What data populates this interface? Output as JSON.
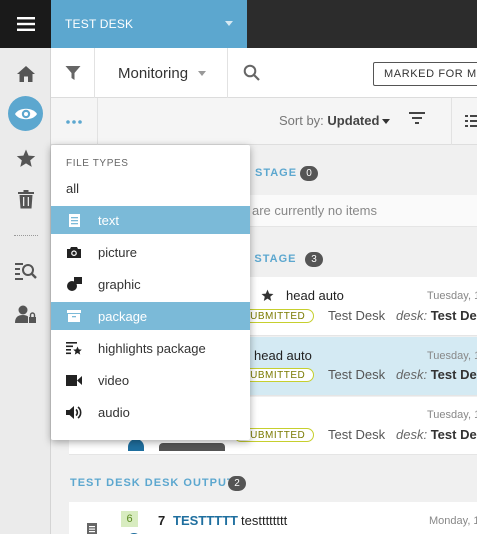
{
  "header": {
    "desk_name": "TEST DESK"
  },
  "toolbar": {
    "view_label": "Monitoring",
    "marked_button": "MARKED FOR ME"
  },
  "subbar": {
    "sort_prefix": "Sort by:",
    "sort_value": "Updated"
  },
  "dropdown": {
    "heading": "FILE TYPES",
    "items": [
      {
        "label": "all",
        "icon": "none",
        "selected": false
      },
      {
        "label": "text",
        "icon": "text-icon",
        "selected": true
      },
      {
        "label": "picture",
        "icon": "camera-icon",
        "selected": false
      },
      {
        "label": "graphic",
        "icon": "graphic-icon",
        "selected": false
      },
      {
        "label": "package",
        "icon": "package-icon",
        "selected": true
      },
      {
        "label": "highlights package",
        "icon": "highlights-icon",
        "selected": false
      },
      {
        "label": "video",
        "icon": "video-icon",
        "selected": false
      },
      {
        "label": "audio",
        "icon": "audio-icon",
        "selected": false
      }
    ]
  },
  "groups": [
    {
      "title_fragment": "STAGE",
      "count": "0",
      "empty_text": "are currently no items"
    },
    {
      "title_fragment": "E STAGE",
      "count": "3"
    },
    {
      "title": "TEST DESK DESK OUTPUT",
      "count": "2"
    }
  ],
  "items": [
    {
      "headline": "head auto",
      "starred": true,
      "status": "SUBMITTED",
      "desk": "Test Desk",
      "desk_label": "desk:",
      "desk_value": "Test Des",
      "when": "Tuesday, 1"
    },
    {
      "headline": "head auto",
      "starred": false,
      "status": "SUBMITTED",
      "desk": "Test Desk",
      "desk_label": "desk:",
      "desk_value": "Test Des",
      "when": "Tuesday, 1"
    },
    {
      "headline": "",
      "starred": false,
      "status": "SUBMITTED",
      "desk": "Test Desk",
      "desk_label": "desk:",
      "desk_value": "Test Des",
      "when": "Tuesday, 1"
    }
  ],
  "output_item": {
    "version": "6",
    "number": "7",
    "slug": "TESTTTTT",
    "headline": "testttttttt",
    "when": "Monday, 1"
  },
  "colors": {
    "accent": "#5ca7cf",
    "selected_row": "#7bbad8",
    "highlight_card": "#d4eaf3",
    "badge_border": "#c6cf2e"
  }
}
